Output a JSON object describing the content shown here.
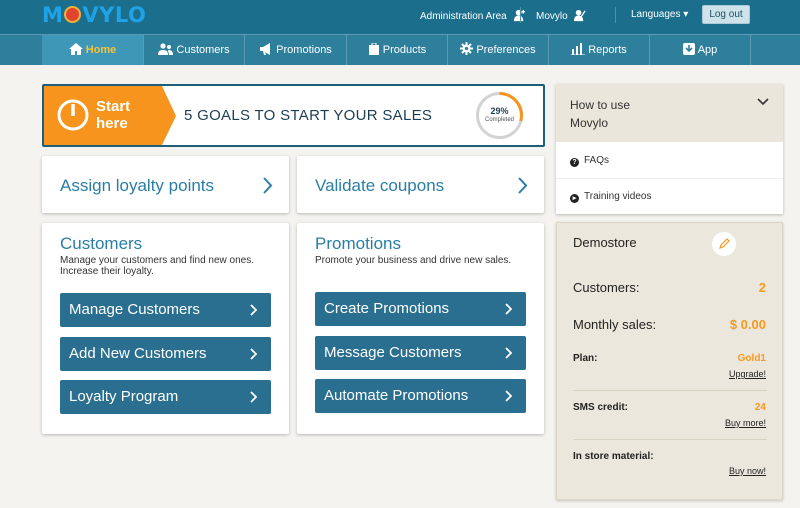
{
  "brand": {
    "logo": "MOVYLO",
    "logo_before": "M",
    "logo_after": "VYLO"
  },
  "topbar": {
    "admin_area": "Administration Area",
    "user": "Movylo",
    "languages": "Languages ▾",
    "logout": "Log out"
  },
  "nav": [
    {
      "label": "Home",
      "icon": "home-icon",
      "active": true
    },
    {
      "label": "Customers",
      "icon": "users-icon"
    },
    {
      "label": "Promotions",
      "icon": "megaphone-icon"
    },
    {
      "label": "Products",
      "icon": "box-icon"
    },
    {
      "label": "Preferences",
      "icon": "gear-icon"
    },
    {
      "label": "Reports",
      "icon": "bar-chart-icon"
    },
    {
      "label": "App",
      "icon": "download-icon"
    }
  ],
  "goals": {
    "start": "Start",
    "here": "here",
    "title": "5 GOALS TO START YOUR SALES",
    "progress_pct": "29%",
    "progress_value": 0.29,
    "progress_label": "Completed"
  },
  "quick": {
    "assign": "Assign loyalty points",
    "validate": "Validate coupons"
  },
  "customers": {
    "title": "Customers",
    "desc": "Manage your customers and find new ones. Increase their loyalty.",
    "buttons": [
      "Manage Customers",
      "Add New Customers",
      "Loyalty Program"
    ]
  },
  "promotions": {
    "title": "Promotions",
    "desc": "Promote your business and drive new sales.",
    "buttons": [
      "Create Promotions",
      "Message Customers",
      "Automate Promotions"
    ]
  },
  "howto": {
    "title_line1": "How to use",
    "title_line2": "Movylo",
    "items": [
      "FAQs",
      "Training videos"
    ]
  },
  "store": {
    "name": "Demostore",
    "customers_label": "Customers:",
    "customers_value": "2",
    "sales_label": "Monthly sales:",
    "sales_value": "$ 0.00",
    "plan_label": "Plan:",
    "plan_value": "Gold1",
    "plan_link": "Upgrade!",
    "sms_label": "SMS credit:",
    "sms_value": "24",
    "sms_link": "Buy more!",
    "material_label": "In store material:",
    "material_link": "Buy now!"
  },
  "colors": {
    "topbar": "#1c6f8c",
    "nav": "#2e7f9c",
    "accent_orange": "#f7941d",
    "button_blue": "#2a6f8f",
    "title_blue": "#2a7ea6"
  }
}
